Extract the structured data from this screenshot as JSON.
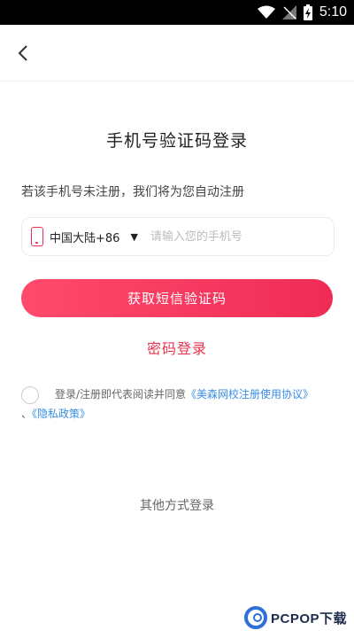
{
  "status_bar": {
    "time": "5:10"
  },
  "nav": {
    "back_icon": "chevron-left-icon"
  },
  "title": "手机号验证码登录",
  "hint": "若该手机号未注册，我们将为您自动注册",
  "phone": {
    "region_icon": "mobile-phone-icon",
    "region_label": "中国大陆+86",
    "caret": "▼",
    "value": "",
    "placeholder": "请输入您的手机号"
  },
  "get_code_button": "获取短信验证码",
  "password_login": "密码登录",
  "agreement": {
    "prefix": "登录/注册即代表阅读并同意",
    "terms_link": "《美森网校注册使用协议》",
    "separator": "、",
    "privacy_link": "《隐私政策》"
  },
  "other_login": "其他方式登录",
  "watermark": "PCPOP下载",
  "colors": {
    "accent": "#ef2c56",
    "link": "#3a8ee6",
    "secondary_link": "#e8334f"
  }
}
